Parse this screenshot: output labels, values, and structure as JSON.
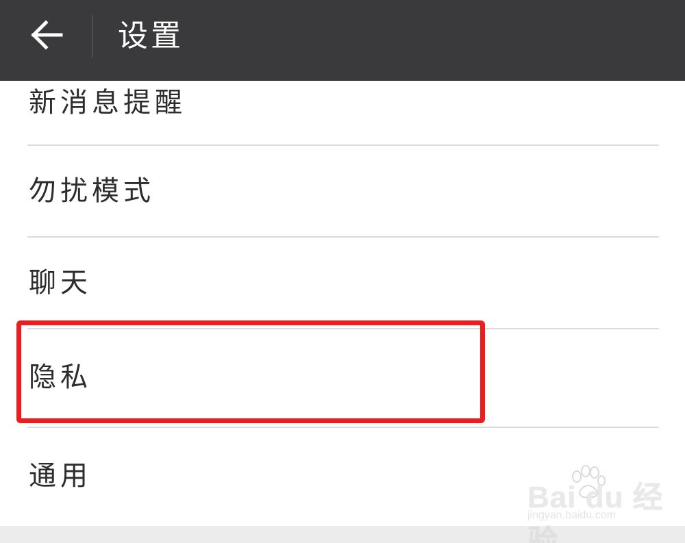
{
  "header": {
    "back_icon": "arrow-left-icon",
    "title": "设置"
  },
  "settings_items": [
    {
      "label": "新消息提醒"
    },
    {
      "label": "勿扰模式"
    },
    {
      "label": "聊天"
    },
    {
      "label": "隐私"
    },
    {
      "label": "通用"
    }
  ],
  "highlight": {
    "target": "隐私",
    "color": "#ee1c1c"
  },
  "colors": {
    "titlebar": "#3a3a3c",
    "background": "#ffffff",
    "divider": "#dcdcdc"
  },
  "watermark": {
    "logo": "Bai du 经验",
    "url": "jingyan.baidu.com"
  }
}
